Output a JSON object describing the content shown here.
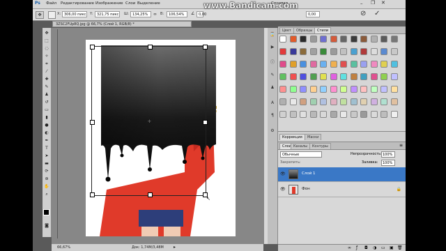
{
  "menu": {
    "logo": "Ps",
    "items": [
      "Файл",
      "Редактирование",
      "Изображение",
      "Слои",
      "Выделение"
    ],
    "last_item": "Справка"
  },
  "watermark": "www.Bandicam.com",
  "options": {
    "x_label": "X:",
    "x_value": "306,00 пикс",
    "y_label": "Y:",
    "y_value": "321,75 пикс",
    "w_label": "Ш:",
    "w_value": "134,25%",
    "h_label": "В:",
    "h_value": "106,54%",
    "angle_value": "0,00",
    "skew_value": "0,00",
    "commit": "✓",
    "cancel": "⊘"
  },
  "document": {
    "tab_title": "3ZSC2FUp8Q.jpg @ 66,7% (Слой 1, RGB/8) *",
    "zoom": "66,67%",
    "doc_info": "Док: 1,74М/3,48М"
  },
  "swatches": {
    "tabs": [
      "Цвет",
      "Образцы",
      "Стили"
    ],
    "active_tab": "Стили"
  },
  "adjustments": {
    "tabs": [
      "Коррекция",
      "Маски"
    ]
  },
  "layers": {
    "tabs": [
      "Слои",
      "Каналы",
      "Контуры"
    ],
    "blend_mode": "Обычные",
    "opacity_label": "Непрозрачность:",
    "opacity_value": "100%",
    "lock_label": "Закрепить:",
    "fill_label": "Заливка:",
    "fill_value": "100%",
    "items": [
      {
        "name": "Слой 1",
        "selected": true
      },
      {
        "name": "Фон",
        "selected": false
      }
    ]
  },
  "colors": {
    "accent": "#3a78c6",
    "panel": "#d6d6d6",
    "canvas_bg": "#878787"
  }
}
